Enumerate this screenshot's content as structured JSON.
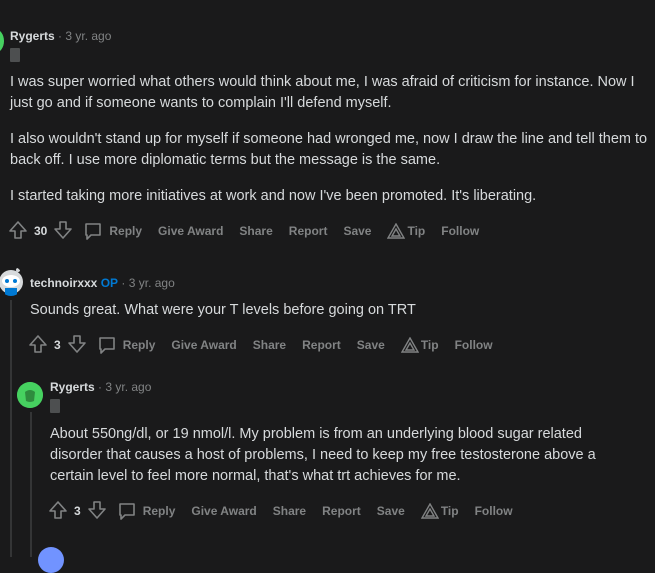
{
  "comments": [
    {
      "author": "Rygerts",
      "time": "· 3 yr. ago",
      "paragraphs": [
        "I was super worried what others would think about me, I was afraid of criticism for instance. Now I just go and if someone wants to complain I'll defend myself.",
        "I also wouldn't stand up for myself if someone had wronged me, now I draw the line and tell them to back off. I use more diplomatic terms but the message is the same.",
        "I started taking more initiatives at work and now I've been promoted. It's liberating."
      ],
      "score": "30"
    },
    {
      "author": "technoirxxx",
      "op": "OP",
      "time": "· 3 yr. ago",
      "paragraphs": [
        "Sounds great. What were your T levels before going on TRT"
      ],
      "score": "3"
    },
    {
      "author": "Rygerts",
      "time": "· 3 yr. ago",
      "paragraphs": [
        "About 550ng/dl, or 19 nmol/l. My problem is from an underlying blood sugar related disorder that causes a host of problems, I need to keep my free testosterone above a certain level to feel more normal, that's what trt achieves for me."
      ],
      "score": "3"
    }
  ],
  "actions": {
    "reply": "Reply",
    "give_award": "Give Award",
    "share": "Share",
    "report": "Report",
    "save": "Save",
    "tip": "Tip",
    "follow": "Follow"
  },
  "colors": {
    "background": "#1a1a1b",
    "text": "#d7dadc",
    "muted": "#818384",
    "op_blue": "#0079d3",
    "avatar_green": "#46d160"
  }
}
